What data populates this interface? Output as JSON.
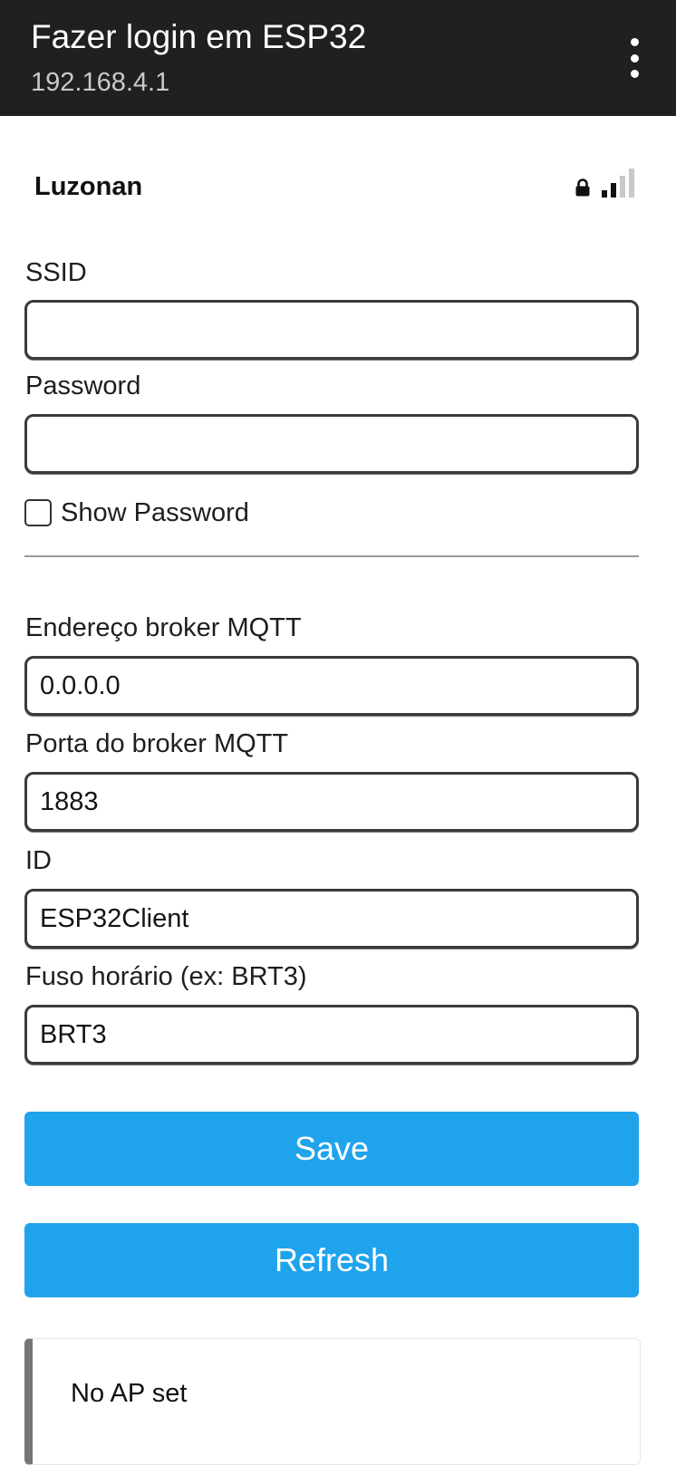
{
  "header": {
    "title": "Fazer login em ESP32",
    "url": "192.168.4.1",
    "menu_icon": "more-vert-icon"
  },
  "network": {
    "name": "Luzonan",
    "secured": true,
    "signal_bars_filled": 2,
    "signal_bars_total": 4,
    "icons": [
      "lock-icon",
      "signal-strength-icon"
    ]
  },
  "form": {
    "ssid_label": "SSID",
    "ssid_value": "",
    "password_label": "Password",
    "password_value": "",
    "show_password_label": "Show Password",
    "show_password_checked": false,
    "mqtt_address_label": "Endereço broker MQTT",
    "mqtt_address_value": "0.0.0.0",
    "mqtt_port_label": "Porta do broker MQTT",
    "mqtt_port_value": "1883",
    "id_label": "ID",
    "id_value": "ESP32Client",
    "timezone_label": "Fuso horário (ex: BRT3)",
    "timezone_value": "BRT3"
  },
  "buttons": {
    "save": "Save",
    "refresh": "Refresh"
  },
  "status": {
    "message": "No AP set"
  },
  "colors": {
    "header_bg": "#202020",
    "button_bg": "#1fa3ec",
    "status_border": "#757575"
  }
}
